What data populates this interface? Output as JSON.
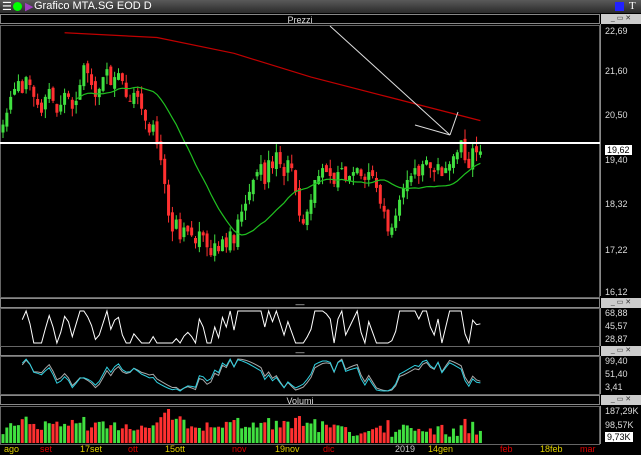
{
  "window": {
    "title": "Grafico MTA.SG EOD D"
  },
  "panels": {
    "price": "Prezzi",
    "osc1": "—",
    "osc2": "—",
    "volume": "Volumi"
  },
  "price_axis": [
    "22,69",
    "21,60",
    "20,50",
    "19,40",
    "18,32",
    "17,22",
    "16,12"
  ],
  "last_price": "19,62",
  "osc1_axis": [
    "68,88",
    "45,57",
    "28,87"
  ],
  "osc2_axis": [
    "99,40",
    "51,40",
    "3,41"
  ],
  "volume_axis": [
    "187,29K",
    "98,57K"
  ],
  "last_volume": "9,73K",
  "x_axis": [
    {
      "t": "ago",
      "c": "#e0d000"
    },
    {
      "t": "set",
      "c": "#e00000"
    },
    {
      "t": "17set",
      "c": "#e0d000"
    },
    {
      "t": "ott",
      "c": "#e00000"
    },
    {
      "t": "15ott",
      "c": "#e0d000"
    },
    {
      "t": "nov",
      "c": "#e00000"
    },
    {
      "t": "19nov",
      "c": "#e0d000"
    },
    {
      "t": "dic",
      "c": "#e00000"
    },
    {
      "t": "2019",
      "c": "#cccccc"
    },
    {
      "t": "14gen",
      "c": "#e0d000"
    },
    {
      "t": "feb",
      "c": "#e00000"
    },
    {
      "t": "18feb",
      "c": "#e0d000"
    },
    {
      "t": "mar",
      "c": "#e00000"
    }
  ],
  "chart_data": {
    "type": "candlestick",
    "ylim": [
      16.12,
      22.69
    ],
    "closes": [
      20.3,
      20.6,
      21.0,
      21.2,
      21.4,
      21.1,
      21.5,
      21.3,
      21.0,
      20.8,
      20.6,
      21.0,
      21.2,
      20.9,
      20.6,
      20.8,
      21.1,
      21.0,
      20.7,
      20.9,
      21.3,
      21.8,
      21.6,
      21.3,
      21.0,
      21.2,
      21.5,
      21.7,
      21.3,
      21.5,
      21.6,
      21.4,
      21.0,
      20.9,
      21.1,
      21.0,
      20.7,
      20.4,
      20.1,
      20.3,
      19.8,
      19.4,
      18.8,
      18.0,
      17.6,
      17.9,
      17.4,
      17.7,
      17.6,
      17.5,
      17.3,
      17.6,
      17.5,
      17.2,
      17.0,
      17.3,
      17.1,
      17.4,
      17.2,
      17.6,
      17.3,
      17.9,
      18.1,
      18.3,
      18.6,
      18.9,
      19.1,
      19.3,
      18.8,
      19.4,
      19.2,
      19.6,
      19.3,
      19.0,
      19.4,
      19.2,
      18.6,
      18.0,
      17.8,
      18.1,
      18.4,
      18.9,
      19.0,
      19.2,
      19.1,
      19.0,
      18.8,
      19.1,
      19.2,
      18.9,
      19.0,
      19.1,
      19.2,
      19.0,
      18.9,
      19.1,
      19.0,
      18.7,
      18.3,
      18.1,
      17.6,
      17.7,
      18.0,
      18.4,
      18.7,
      18.9,
      19.0,
      19.2,
      19.0,
      19.3,
      19.4,
      19.2,
      19.1,
      19.3,
      19.0,
      19.2,
      19.3,
      19.5,
      19.6,
      19.9,
      19.4,
      19.2,
      19.7,
      19.6,
      19.62
    ],
    "ma200": [
      [
        16,
        22.62
      ],
      [
        40,
        22.5
      ],
      [
        60,
        22.1
      ],
      [
        80,
        21.5
      ],
      [
        100,
        21.0
      ],
      [
        124,
        20.4
      ]
    ]
  }
}
